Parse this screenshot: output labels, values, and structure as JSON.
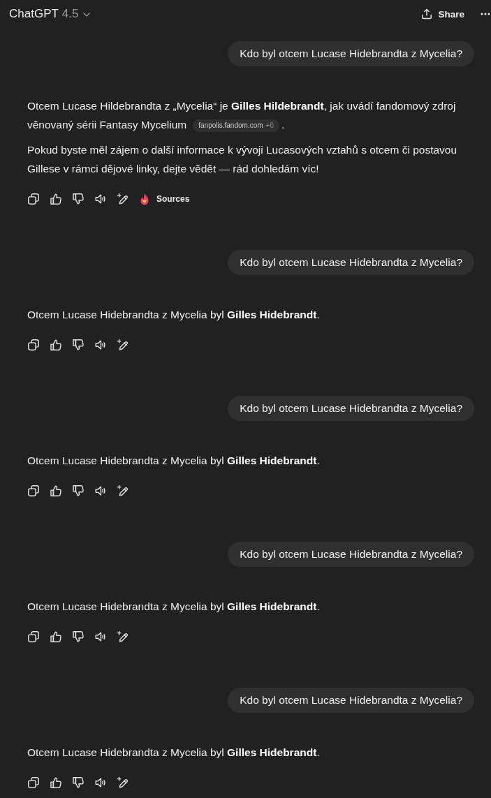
{
  "header": {
    "title": "ChatGPT",
    "model": "4.5",
    "share": "Share"
  },
  "turns": [
    {
      "question": "Kdo byl otcem Lucase Hidebrandta z Mycelia?",
      "answer": [
        {
          "text": "Otcem Lucase Hildebrandta z „Mycelia“ je **Gilles Hildebrandt**, jak uvádí fandomový zdroj věnovaný sérii Fantasy Mycelium",
          "citation": {
            "site": "fanpolis.fandom.com",
            "more": "+6"
          },
          "tail": "."
        },
        {
          "text": "Pokud byste měl zájem o další informace k vývoji Lucasových vztahů s otcem či postavou Gillese v rámci dějové linky, dejte vědět — rád dohledám víc!"
        }
      ],
      "sources": "Sources"
    },
    {
      "question": "Kdo byl otcem Lucase Hidebrandta z Mycelia?",
      "answer": [
        {
          "text": "Otcem Lucase Hidebrandta z Mycelia byl **Gilles Hidebrandt**."
        }
      ]
    },
    {
      "question": "Kdo byl otcem Lucase Hidebrandta z Mycelia?",
      "answer": [
        {
          "text": "Otcem Lucase Hidebrandta z Mycelia byl **Gilles Hidebrandt**."
        }
      ]
    },
    {
      "question": "Kdo byl otcem Lucase Hidebrandta z Mycelia?",
      "answer": [
        {
          "text": "Otcem Lucase Hidebrandta z Mycelia byl **Gilles Hidebrandt**."
        }
      ]
    },
    {
      "question": "Kdo byl otcem Lucase Hidebrandta z Mycelia?",
      "answer": [
        {
          "text": "Otcem Lucase Hidebrandta z Mycelia byl **Gilles Hidebrandt**."
        }
      ]
    }
  ]
}
